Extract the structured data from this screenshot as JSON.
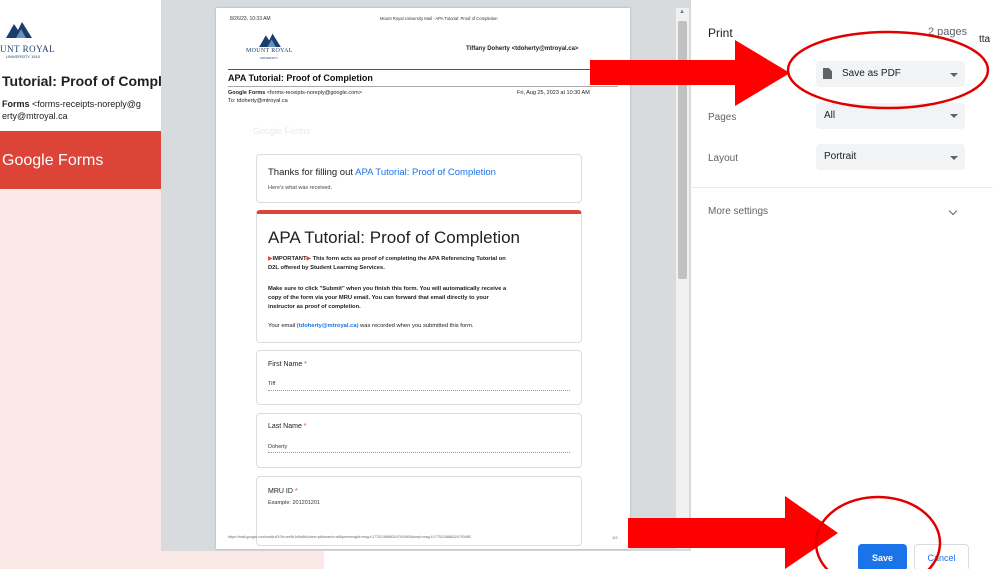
{
  "background_email": {
    "logo_text": "UNT ROYAL",
    "logo_sub": "UNIVERSITY 1910",
    "title": "Tutorial: Proof of Comple",
    "from_name": "Forms",
    "from_addr": " <forms-receipts-noreply@g",
    "to_addr": "erty@mtroyal.ca",
    "banner_text": "Google Forms"
  },
  "preview": {
    "header_left": "8/26/23, 10:33 AM",
    "header_center": "Mount Royal University Mail - APA Tutorial: Proof of Completion",
    "logo_line1": "MOUNT ROYAL",
    "logo_line2": "UNIVERSITY",
    "recipient": "Tiffany Doherty <tdoherty@mtroyal.ca>",
    "subject": "APA Tutorial: Proof of Completion",
    "from_name": "Google Forms",
    "from_addr": " <forms-receipts-noreply@google.com>",
    "date": "Fri, Aug 25, 2023 at 10:30 AM",
    "to": "To: tdoherty@mtroyal.ca",
    "ghost": "Google Forms",
    "thanks_prefix": "Thanks for filling out ",
    "thanks_link": "APA Tutorial: Proof of Completion",
    "thanks_sub": "Here's what was received.",
    "form_title": "APA Tutorial: Proof of Completion",
    "important_flag": "▶",
    "important_label": "IMPORTANT",
    "important_text": " This form acts as proof of completing the APA Referencing Tutorial on",
    "important_text2": "D2L offered by Student Learning Services.",
    "submit_line1": "Make sure to click \"Submit\" when you finish this form. You will automatically receive a",
    "submit_line2": "copy of the form via your MRU email. You can forward that email directly to your",
    "submit_line3": "instructor as proof of completion.",
    "email_prefix": "Your email (",
    "email_link": "tdoherty@mtroyal.ca",
    "email_suffix": ") was recorded when you submitted this form.",
    "questions": [
      {
        "label": "First Name",
        "star": " *",
        "value": "Tiff"
      },
      {
        "label": "Last Name",
        "star": " *",
        "value": "Doherty"
      },
      {
        "label": "MRU ID",
        "star": " *",
        "value": "Example: 201201201"
      }
    ],
    "footer_url": "https://mail.google.com/mail/u/0/?ik=ee9b1e5e6b&view=pt&search=all&permmsgid=msg-f:1775218886324793480&simpl=msg-f:1775218886324793480",
    "footer_page": "1/2"
  },
  "print_panel": {
    "title": "Print",
    "pages_count": "2 pages",
    "destination_value": "Save as PDF",
    "pages_label": "Pages",
    "pages_value": "All",
    "layout_label": "Layout",
    "layout_value": "Portrait",
    "more_settings": "More settings",
    "save_button": "Save",
    "cancel_button": "Cancel"
  },
  "cut_off_text": "tta",
  "colors": {
    "google_red": "#db4437",
    "link_blue": "#1a73e8",
    "annotation_red": "#ff0000"
  }
}
